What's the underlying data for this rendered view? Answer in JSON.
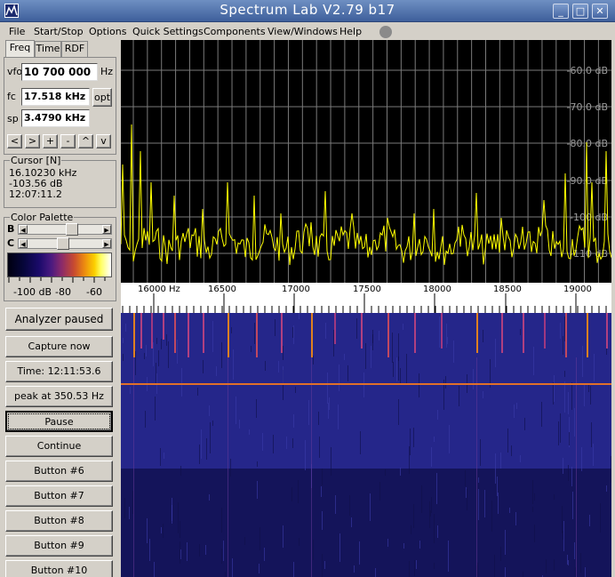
{
  "title": "Spectrum Lab V2.79 b17",
  "window_buttons": {
    "minimize": "_",
    "restore": "□",
    "close": "✕"
  },
  "menu": [
    "File",
    "Start/Stop",
    "Options",
    "Quick Settings",
    "Components",
    "View/Windows",
    "Help"
  ],
  "tabs": [
    {
      "label": "Freq",
      "active": true
    },
    {
      "label": "Time",
      "active": false
    },
    {
      "label": "RDF",
      "active": false
    }
  ],
  "freq": {
    "vfo_label": "vfo",
    "vfo_value": "10 700 000",
    "vfo_unit": "Hz",
    "fc_label": "fc",
    "fc_value": "17.518 kHz",
    "opt_label": "opt",
    "sp_label": "sp",
    "sp_value": "3.4790 kHz",
    "nav_buttons": [
      "<",
      ">",
      "+",
      "-",
      "^",
      "v"
    ]
  },
  "cursor": {
    "title": "Cursor [N]",
    "freq": "16.10230 kHz",
    "level": "-103.56 dB",
    "time": "12:07:11.2"
  },
  "palette": {
    "title": "Color Palette",
    "brightness_label": "B",
    "contrast_label": "C",
    "scale_labels": [
      "-100 dB",
      "-80",
      "-60"
    ],
    "brightness_level": 0.6,
    "contrast_level": 0.45
  },
  "buttons": [
    "Analyzer paused",
    "Capture now",
    "Time:  12:11:53.6",
    "peak at 350.53 Hz",
    "Pause",
    "Continue",
    "Button #6",
    "Button #7",
    "Button #8",
    "Button #9",
    "Button #10"
  ],
  "spectrum": {
    "db_labels": [
      "-60.0 dB",
      "-70.0 dB",
      "-80.0 dB",
      "-90.0 dB",
      "-100 dB",
      "-110 dB"
    ],
    "freq_labels": [
      "16000 Hz",
      "16500",
      "17000",
      "17500",
      "18000",
      "18500",
      "19000"
    ],
    "trace_color": "#ffff00",
    "grid_color": "#7a7a7a",
    "waterfall_color": "#1a1a70"
  }
}
